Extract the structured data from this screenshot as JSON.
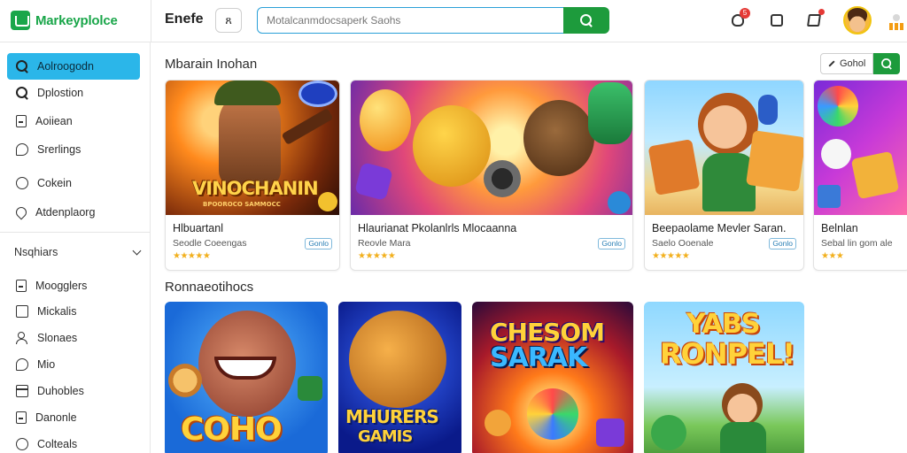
{
  "brand": {
    "name": "Markeyplolce",
    "color": "#1aa64a"
  },
  "header": {
    "page_label": "Enefe",
    "square_button": "ጸ",
    "search": {
      "placeholder": "Motalcanmdocsaperk Saohs",
      "button_icon": "search-icon"
    },
    "notification_count": "5",
    "icons": [
      "bell-icon",
      "bag-icon",
      "tag-icon",
      "avatar",
      "menu-icon"
    ]
  },
  "sidebar": {
    "primary": [
      {
        "label": "Aolroogodn",
        "icon": "search-icon",
        "active": true
      },
      {
        "label": "Dplostion",
        "icon": "search-icon",
        "active": false
      },
      {
        "label": "Aoiiean",
        "icon": "document-icon",
        "active": false
      },
      {
        "label": "Srerlings",
        "icon": "chat-icon",
        "active": false
      },
      {
        "label": "Cokein",
        "icon": "circle-icon",
        "active": false
      },
      {
        "label": "Atdenplaorg",
        "icon": "pin-icon",
        "active": false
      }
    ],
    "section_label": "Nsqhiars",
    "secondary": [
      {
        "label": "Moogglers",
        "icon": "document-icon"
      },
      {
        "label": "Mickalis",
        "icon": "square-icon"
      },
      {
        "label": "Slonaes",
        "icon": "people-icon"
      },
      {
        "label": "Mio",
        "icon": "chat-icon"
      },
      {
        "label": "Duhobles",
        "icon": "calendar-icon"
      },
      {
        "label": "Danonle",
        "icon": "document-icon"
      },
      {
        "label": "Colteals",
        "icon": "circle-icon"
      }
    ]
  },
  "main": {
    "section1_title": "Mbarain Inohan",
    "filter_label": "Gohol",
    "featured": [
      {
        "title": "Hlbuartanl",
        "subtitle": "Seodle Coeengas",
        "badge": "Gonlo",
        "stars": "★★★★★",
        "art_text": "VINOCHANIN",
        "art_subtext": "BPOOROCO SAMMOCC"
      },
      {
        "title": "Hlaurianat Pkolanlrls Mlocaanna",
        "subtitle": "Reovle Mara",
        "badge": "Gonlo",
        "stars": "★★★★★",
        "art_text": "",
        "art_subtext": ""
      },
      {
        "title": "Beepaolame Mevler Saran.",
        "subtitle": "Saelo Ooenale",
        "badge": "Gonlo",
        "stars": "★★★★★",
        "art_text": "",
        "art_subtext": ""
      },
      {
        "title": "Belnlan",
        "subtitle": "Sebal lin gom ale",
        "badge": "",
        "stars": "★★★",
        "art_text": "",
        "art_subtext": ""
      }
    ],
    "section2_title": "Ronnaeotihocs",
    "tiles": [
      {
        "art_text": "COHO"
      },
      {
        "art_text": "MHURERS",
        "art_subtext": "GAMIS"
      },
      {
        "art_text": "CHESOM",
        "art_subtext": "SARAK"
      },
      {
        "art_text": "YABS",
        "art_subtext": "RONPEL!"
      }
    ]
  }
}
